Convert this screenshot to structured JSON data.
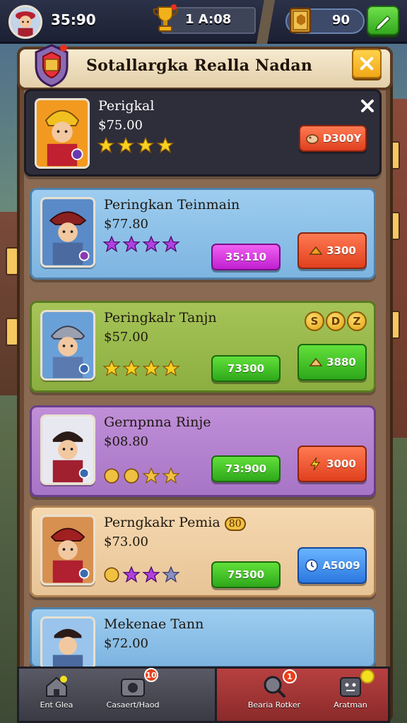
{
  "topbar": {
    "time": "35:90",
    "trophy_value": "1  A:08",
    "gold_value": "90"
  },
  "header": {
    "title": "Sotallargka Realla Nadan"
  },
  "cards": [
    {
      "name": "Perigkal",
      "price": "$75.00",
      "stars": 4,
      "star_color": "gold",
      "action_label": "D300Y",
      "action_color": "#e0401e"
    },
    {
      "name": "Peringkan Teinmain",
      "price": "$77.80",
      "stars": 4,
      "star_color": "purple",
      "secondary_label": "35:110",
      "action_label": "3300",
      "action_color": "#e0401e"
    },
    {
      "name": "Peringkalr Tanjn",
      "price": "$57.00",
      "stars": 4,
      "star_color": "gold",
      "badges": [
        "S",
        "D",
        "Z"
      ],
      "secondary_label": "73300",
      "action_label": "3880",
      "action_color": "#2ea81a"
    },
    {
      "name": "Gernpnna Rinje",
      "price": "$08.80",
      "stars": 4,
      "star_color": "mixed",
      "secondary_label": "73:900",
      "action_label": "3000",
      "action_color": "#e0401e"
    },
    {
      "name": "Perngkakr Pemia",
      "name_badge": "80",
      "price": "$73.00",
      "stars": 4,
      "star_color": "purple",
      "secondary_label": "75300",
      "action_label": "A5009",
      "action_color": "#2a78e0"
    },
    {
      "name": "Mekenae Tann",
      "price": "$72.00",
      "stars": 0,
      "star_color": "gold",
      "secondary_label": "",
      "action_label": "",
      "action_color": "#e0401e"
    }
  ],
  "bottom_nav": [
    {
      "label": "Ent Glea",
      "icon": "home-icon",
      "badge": ""
    },
    {
      "label": "Casaert/Haod",
      "icon": "camera-icon",
      "badge": "10"
    },
    {
      "label": "Bearia Rotker",
      "icon": "search-icon",
      "badge": "1"
    },
    {
      "label": "Aratman",
      "icon": "face-icon",
      "badge": ""
    }
  ]
}
